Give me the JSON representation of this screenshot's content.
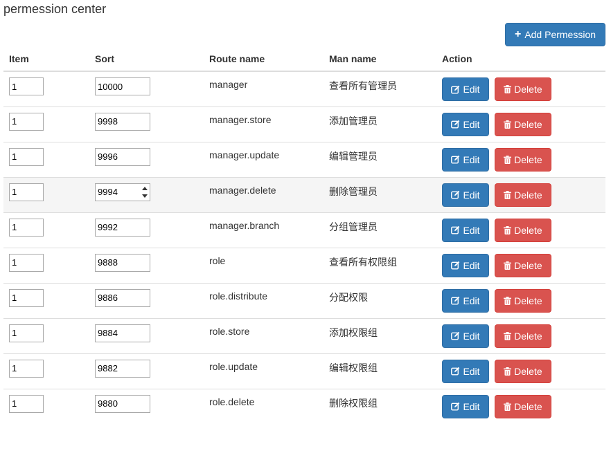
{
  "page": {
    "title": "permession center"
  },
  "toolbar": {
    "add_label": "Add Permession",
    "add_icon": "plus-icon"
  },
  "table": {
    "columns": [
      "Item",
      "Sort",
      "Route name",
      "Man name",
      "Action"
    ],
    "edit_label": "Edit",
    "delete_label": "Delete",
    "edit_icon": "edit-icon",
    "delete_icon": "trash-icon",
    "rows": [
      {
        "item": "1",
        "sort": "10000",
        "route": "manager",
        "name": "查看所有管理员"
      },
      {
        "item": "1",
        "sort": "9998",
        "route": "manager.store",
        "name": "添加管理员"
      },
      {
        "item": "1",
        "sort": "9996",
        "route": "manager.update",
        "name": "编辑管理员"
      },
      {
        "item": "1",
        "sort": "9994",
        "route": "manager.delete",
        "name": "删除管理员"
      },
      {
        "item": "1",
        "sort": "9992",
        "route": "manager.branch",
        "name": "分组管理员"
      },
      {
        "item": "1",
        "sort": "9888",
        "route": "role",
        "name": "查看所有权限组"
      },
      {
        "item": "1",
        "sort": "9886",
        "route": "role.distribute",
        "name": "分配权限"
      },
      {
        "item": "1",
        "sort": "9884",
        "route": "role.store",
        "name": "添加权限组"
      },
      {
        "item": "1",
        "sort": "9882",
        "route": "role.update",
        "name": "编辑权限组"
      },
      {
        "item": "1",
        "sort": "9880",
        "route": "role.delete",
        "name": "删除权限组"
      }
    ]
  },
  "colors": {
    "primary": "#337ab7",
    "danger": "#d9534f",
    "row_highlight": "#f5f5f5",
    "border": "#dddddd"
  }
}
